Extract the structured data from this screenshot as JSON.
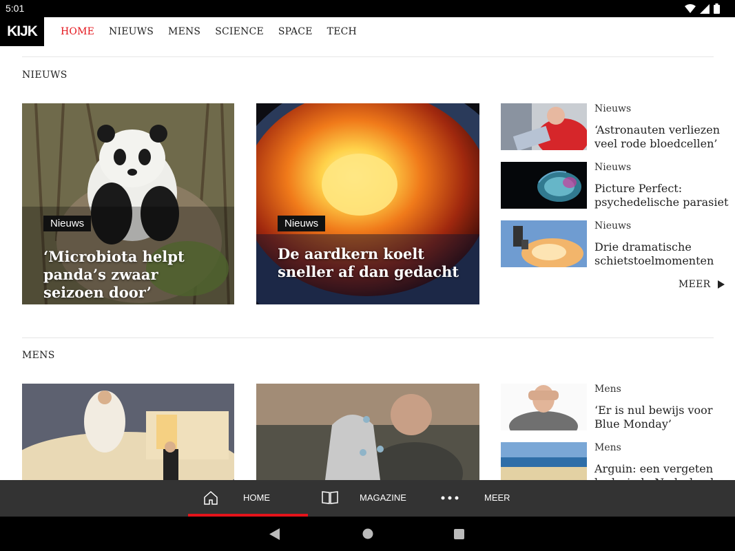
{
  "status_bar": {
    "time": "5:01"
  },
  "app": {
    "logo": "KIJK",
    "nav": [
      "HOME",
      "NIEUWS",
      "MENS",
      "SCIENCE",
      "SPACE",
      "TECH"
    ],
    "active_nav": "HOME"
  },
  "sections": [
    {
      "title": "NIEUWS",
      "featured": [
        {
          "badge": "Nieuws",
          "headline": "‘Microbiota helpt panda’s zwaar seizoen door’"
        },
        {
          "badge": "Nieuws",
          "headline": "De aardkern koelt sneller af dan gedacht"
        }
      ],
      "side": [
        {
          "category": "Nieuws",
          "title": "‘Astronauten verliezen veel rode bloedcellen’"
        },
        {
          "category": "Nieuws",
          "title": "Picture Perfect: psychedelische parasiet"
        },
        {
          "category": "Nieuws",
          "title": "Drie dramatische schietstoelmomenten"
        }
      ],
      "more": "MEER"
    },
    {
      "title": "MENS",
      "side": [
        {
          "category": "Mens",
          "title": "‘Er is nul bewijs voor Blue Monday’"
        },
        {
          "category": "Mens",
          "title": "Arguin: een vergeten bedreigde Nederlandse"
        }
      ]
    }
  ],
  "tabbar": {
    "tabs": [
      {
        "label": "HOME",
        "icon": "home-icon",
        "active": true
      },
      {
        "label": "MAGAZINE",
        "icon": "book-icon"
      },
      {
        "label": "MEER",
        "icon": "more-dots-icon"
      }
    ]
  },
  "colors": {
    "accent": "#e4141b",
    "tabbar": "#333333"
  }
}
